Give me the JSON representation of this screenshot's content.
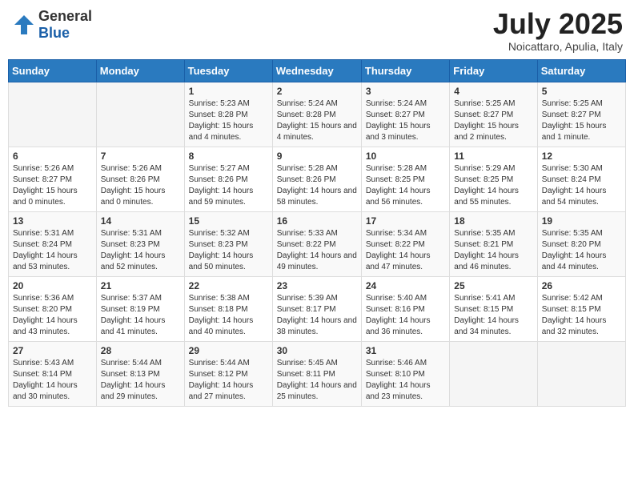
{
  "header": {
    "logo_general": "General",
    "logo_blue": "Blue",
    "title": "July 2025",
    "location": "Noicattaro, Apulia, Italy"
  },
  "weekdays": [
    "Sunday",
    "Monday",
    "Tuesday",
    "Wednesday",
    "Thursday",
    "Friday",
    "Saturday"
  ],
  "weeks": [
    [
      {
        "day": "",
        "detail": ""
      },
      {
        "day": "",
        "detail": ""
      },
      {
        "day": "1",
        "detail": "Sunrise: 5:23 AM\nSunset: 8:28 PM\nDaylight: 15 hours and 4 minutes."
      },
      {
        "day": "2",
        "detail": "Sunrise: 5:24 AM\nSunset: 8:28 PM\nDaylight: 15 hours and 4 minutes."
      },
      {
        "day": "3",
        "detail": "Sunrise: 5:24 AM\nSunset: 8:27 PM\nDaylight: 15 hours and 3 minutes."
      },
      {
        "day": "4",
        "detail": "Sunrise: 5:25 AM\nSunset: 8:27 PM\nDaylight: 15 hours and 2 minutes."
      },
      {
        "day": "5",
        "detail": "Sunrise: 5:25 AM\nSunset: 8:27 PM\nDaylight: 15 hours and 1 minute."
      }
    ],
    [
      {
        "day": "6",
        "detail": "Sunrise: 5:26 AM\nSunset: 8:27 PM\nDaylight: 15 hours and 0 minutes."
      },
      {
        "day": "7",
        "detail": "Sunrise: 5:26 AM\nSunset: 8:26 PM\nDaylight: 15 hours and 0 minutes."
      },
      {
        "day": "8",
        "detail": "Sunrise: 5:27 AM\nSunset: 8:26 PM\nDaylight: 14 hours and 59 minutes."
      },
      {
        "day": "9",
        "detail": "Sunrise: 5:28 AM\nSunset: 8:26 PM\nDaylight: 14 hours and 58 minutes."
      },
      {
        "day": "10",
        "detail": "Sunrise: 5:28 AM\nSunset: 8:25 PM\nDaylight: 14 hours and 56 minutes."
      },
      {
        "day": "11",
        "detail": "Sunrise: 5:29 AM\nSunset: 8:25 PM\nDaylight: 14 hours and 55 minutes."
      },
      {
        "day": "12",
        "detail": "Sunrise: 5:30 AM\nSunset: 8:24 PM\nDaylight: 14 hours and 54 minutes."
      }
    ],
    [
      {
        "day": "13",
        "detail": "Sunrise: 5:31 AM\nSunset: 8:24 PM\nDaylight: 14 hours and 53 minutes."
      },
      {
        "day": "14",
        "detail": "Sunrise: 5:31 AM\nSunset: 8:23 PM\nDaylight: 14 hours and 52 minutes."
      },
      {
        "day": "15",
        "detail": "Sunrise: 5:32 AM\nSunset: 8:23 PM\nDaylight: 14 hours and 50 minutes."
      },
      {
        "day": "16",
        "detail": "Sunrise: 5:33 AM\nSunset: 8:22 PM\nDaylight: 14 hours and 49 minutes."
      },
      {
        "day": "17",
        "detail": "Sunrise: 5:34 AM\nSunset: 8:22 PM\nDaylight: 14 hours and 47 minutes."
      },
      {
        "day": "18",
        "detail": "Sunrise: 5:35 AM\nSunset: 8:21 PM\nDaylight: 14 hours and 46 minutes."
      },
      {
        "day": "19",
        "detail": "Sunrise: 5:35 AM\nSunset: 8:20 PM\nDaylight: 14 hours and 44 minutes."
      }
    ],
    [
      {
        "day": "20",
        "detail": "Sunrise: 5:36 AM\nSunset: 8:20 PM\nDaylight: 14 hours and 43 minutes."
      },
      {
        "day": "21",
        "detail": "Sunrise: 5:37 AM\nSunset: 8:19 PM\nDaylight: 14 hours and 41 minutes."
      },
      {
        "day": "22",
        "detail": "Sunrise: 5:38 AM\nSunset: 8:18 PM\nDaylight: 14 hours and 40 minutes."
      },
      {
        "day": "23",
        "detail": "Sunrise: 5:39 AM\nSunset: 8:17 PM\nDaylight: 14 hours and 38 minutes."
      },
      {
        "day": "24",
        "detail": "Sunrise: 5:40 AM\nSunset: 8:16 PM\nDaylight: 14 hours and 36 minutes."
      },
      {
        "day": "25",
        "detail": "Sunrise: 5:41 AM\nSunset: 8:15 PM\nDaylight: 14 hours and 34 minutes."
      },
      {
        "day": "26",
        "detail": "Sunrise: 5:42 AM\nSunset: 8:15 PM\nDaylight: 14 hours and 32 minutes."
      }
    ],
    [
      {
        "day": "27",
        "detail": "Sunrise: 5:43 AM\nSunset: 8:14 PM\nDaylight: 14 hours and 30 minutes."
      },
      {
        "day": "28",
        "detail": "Sunrise: 5:44 AM\nSunset: 8:13 PM\nDaylight: 14 hours and 29 minutes."
      },
      {
        "day": "29",
        "detail": "Sunrise: 5:44 AM\nSunset: 8:12 PM\nDaylight: 14 hours and 27 minutes."
      },
      {
        "day": "30",
        "detail": "Sunrise: 5:45 AM\nSunset: 8:11 PM\nDaylight: 14 hours and 25 minutes."
      },
      {
        "day": "31",
        "detail": "Sunrise: 5:46 AM\nSunset: 8:10 PM\nDaylight: 14 hours and 23 minutes."
      },
      {
        "day": "",
        "detail": ""
      },
      {
        "day": "",
        "detail": ""
      }
    ]
  ]
}
